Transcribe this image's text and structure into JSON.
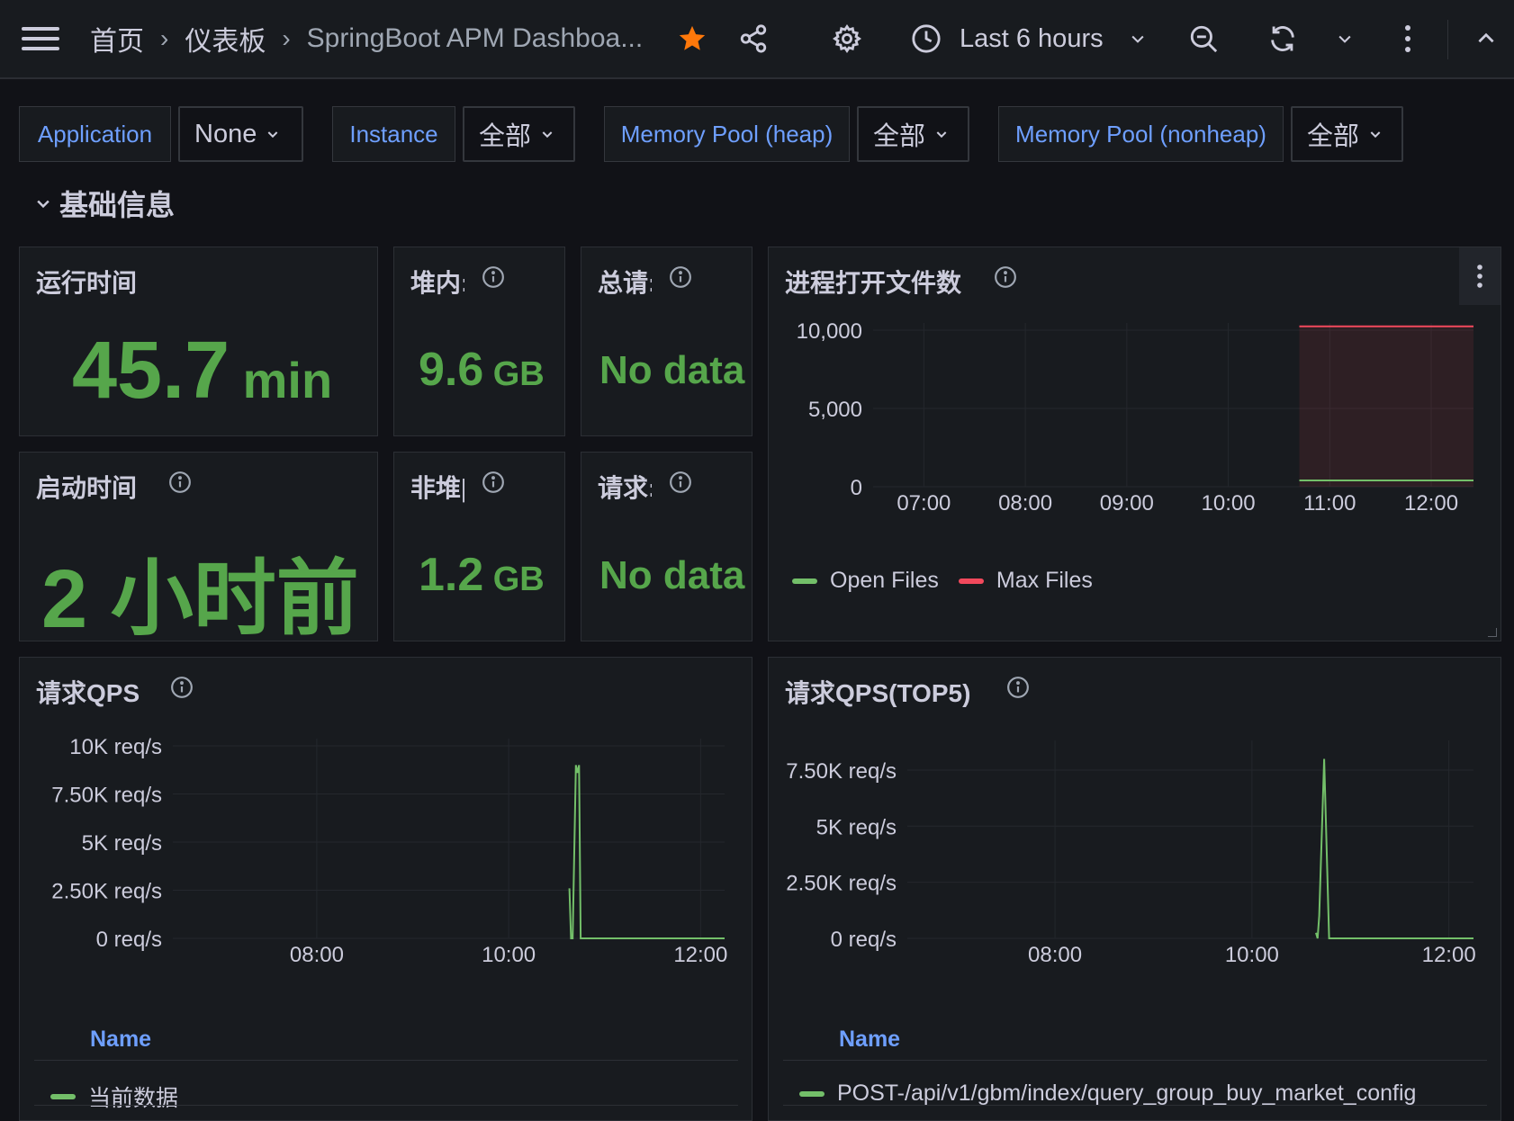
{
  "breadcrumb": {
    "home": "首页",
    "dashboards": "仪表板",
    "current": "SpringBoot APM Dashboa...",
    "separator": "›"
  },
  "time_picker": {
    "label": "Last 6 hours"
  },
  "colors": {
    "accent_blue": "#6e9fff",
    "green": "#56a64b",
    "red": "#f2495c",
    "star": "#ff780a"
  },
  "variables": [
    {
      "label": "Application",
      "value": "None"
    },
    {
      "label": "Instance",
      "value": "全部"
    },
    {
      "label": "Memory Pool (heap)",
      "value": "全部"
    },
    {
      "label": "Memory Pool (nonheap)",
      "value": "全部"
    }
  ],
  "row": {
    "title": "基础信息"
  },
  "panels": {
    "uptime": {
      "title": "运行时间",
      "value": "45.7",
      "unit": "min"
    },
    "heap": {
      "title": "堆内:",
      "value": "9.6",
      "unit": "GB"
    },
    "total_requests": {
      "title": "总请:",
      "value": "No data"
    },
    "start_time": {
      "title": "启动时间",
      "value": "2 小时前"
    },
    "nonheap": {
      "title": "非堆|",
      "value": "1.2",
      "unit": "GB"
    },
    "requests": {
      "title": "请求:",
      "value": "No data"
    },
    "open_files": {
      "title": "进程打开文件数"
    },
    "qps": {
      "title": "请求QPS",
      "name_header": "Name",
      "legend": "当前数据"
    },
    "qps_top5": {
      "title": "请求QPS(TOP5)",
      "name_header": "Name",
      "legend": "POST-/api/v1/gbm/index/query_group_buy_market_config"
    }
  },
  "chart_data": [
    {
      "type": "area",
      "title": "进程打开文件数",
      "ylim": [
        0,
        10000
      ],
      "y_ticks": [
        "10,000",
        "5,000",
        "0"
      ],
      "x_ticks": [
        "07:00",
        "08:00",
        "09:00",
        "10:00",
        "11:00",
        "12:00"
      ],
      "x_range": [
        "06:30",
        "12:25"
      ],
      "series": [
        {
          "name": "Open Files",
          "color": "#73bf69",
          "x": [
            "10:42",
            "12:25"
          ],
          "values": [
            400,
            400
          ]
        },
        {
          "name": "Max Files",
          "color": "#f2495c",
          "x": [
            "10:42",
            "12:25"
          ],
          "values": [
            10240,
            10240
          ]
        }
      ],
      "legend_position": "bottom-left",
      "grid": true
    },
    {
      "type": "line",
      "title": "请求QPS",
      "ylim": [
        0,
        10000
      ],
      "y_ticks": [
        "10K req/s",
        "7.50K req/s",
        "5K req/s",
        "2.50K req/s",
        "0 req/s"
      ],
      "x_ticks": [
        "08:00",
        "10:00",
        "12:00"
      ],
      "x_range": [
        "06:30",
        "12:15"
      ],
      "series": [
        {
          "name": "当前数据",
          "color": "#73bf69",
          "x": [
            "10:38",
            "10:39",
            "10:40",
            "10:42",
            "10:43",
            "10:44",
            "10:45",
            "10:46",
            "10:48",
            "12:15"
          ],
          "values": [
            2600,
            0,
            0,
            9000,
            8600,
            9000,
            0,
            0,
            0,
            0
          ]
        }
      ],
      "legend_position": "bottom",
      "grid": true
    },
    {
      "type": "line",
      "title": "请求QPS(TOP5)",
      "ylim": [
        0,
        8500
      ],
      "y_ticks": [
        "7.50K req/s",
        "5K req/s",
        "2.50K req/s",
        "0 req/s"
      ],
      "x_ticks": [
        "08:00",
        "10:00",
        "12:00"
      ],
      "x_range": [
        "06:30",
        "12:15"
      ],
      "series": [
        {
          "name": "POST-/api/v1/gbm/index/query_group_buy_market_config",
          "color": "#73bf69",
          "x": [
            "10:39",
            "10:40",
            "10:41",
            "10:44",
            "10:47",
            "10:49",
            "12:15"
          ],
          "values": [
            250,
            0,
            1000,
            8000,
            0,
            0,
            0
          ]
        }
      ],
      "legend_position": "bottom",
      "grid": true
    }
  ]
}
